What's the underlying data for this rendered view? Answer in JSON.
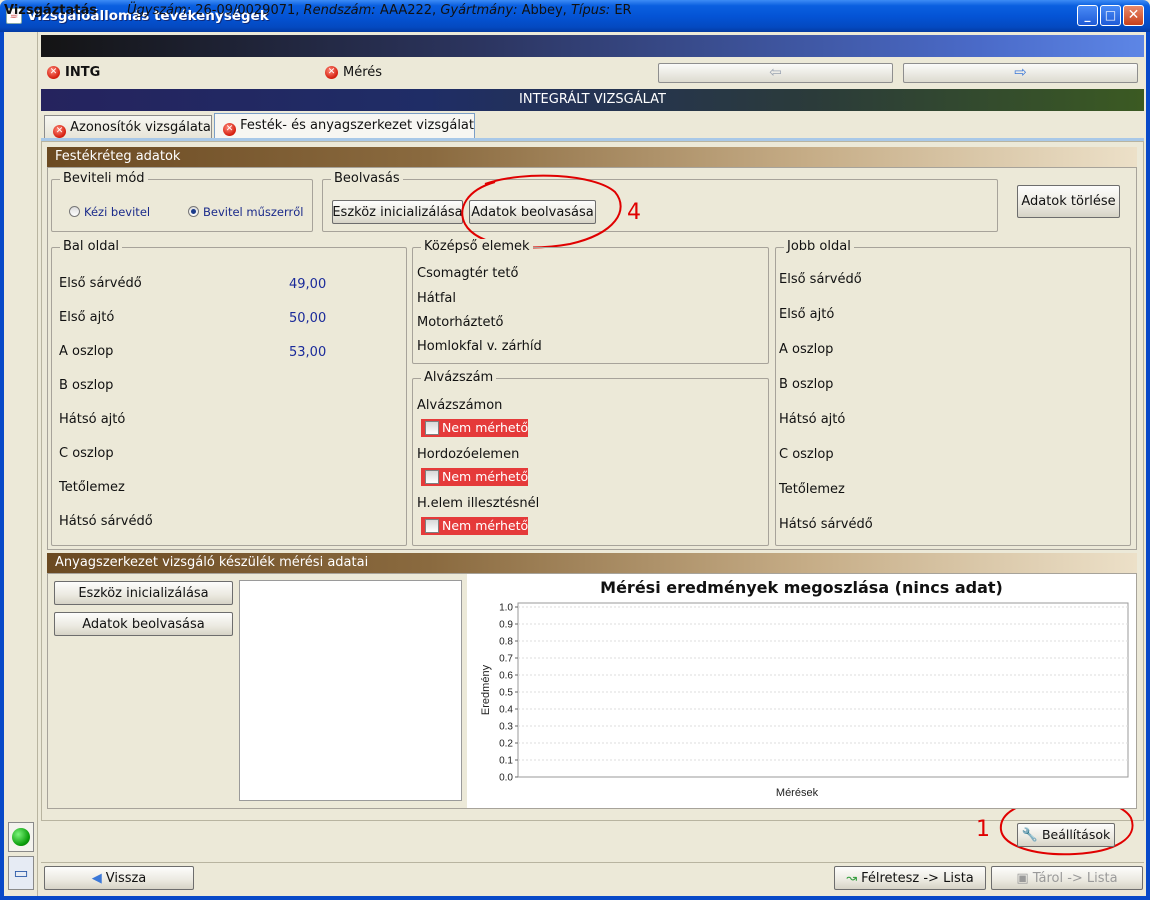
{
  "window": {
    "title": "Vizsgálóállomás tevékenységek",
    "icon_glyph": "☕",
    "minimize": "_",
    "maximize": "□",
    "close": "✕"
  },
  "header": {
    "title": "Vizsgáztatás",
    "ugyszam_label": "Ügyszám:",
    "ugyszam": "26-09/0029071,",
    "rendszam_label": "Rendszám:",
    "rendszam": "AAA222,",
    "gyartmany_label": "Gyártmány:",
    "gyartmany": "Abbey,",
    "tipus_label": "Típus:",
    "tipus": "ER"
  },
  "status_row": {
    "intg": "INTG",
    "meres": "Mérés",
    "nav_back_glyph": "⇦",
    "nav_forward_glyph": "⇨"
  },
  "banner": "INTEGRÁLT VIZSGÁLAT",
  "tabs": [
    "Azonosítók vizsgálata",
    "Festék- és anyagszerkezet vizsgálat"
  ],
  "festek": {
    "header": "Festékréteg adatok",
    "beviteli": {
      "title": "Beviteli mód",
      "options": [
        "Kézi bevitel",
        "Bevitel műszerről"
      ],
      "selected": "Bevitel műszerről"
    },
    "beolvasas": {
      "title": "Beolvasás",
      "init_button": "Eszköz inicializálása",
      "read_button": "Adatok beolvasása"
    },
    "clear_button": "Adatok törlése",
    "bal": {
      "title": "Bal oldal",
      "rows": [
        {
          "label": "Első sárvédő",
          "value": "49,00"
        },
        {
          "label": "Első ajtó",
          "value": "50,00"
        },
        {
          "label": "A oszlop",
          "value": "53,00"
        },
        {
          "label": "B oszlop",
          "value": ""
        },
        {
          "label": "Hátsó ajtó",
          "value": ""
        },
        {
          "label": "C oszlop",
          "value": ""
        },
        {
          "label": "Tetőlemez",
          "value": ""
        },
        {
          "label": "Hátsó sárvédő",
          "value": ""
        }
      ]
    },
    "kozepso": {
      "title": "Középső elemek",
      "rows": [
        "Csomagtér tető",
        "Hátfal",
        "Motorháztető",
        "Homlokfal v. zárhíd"
      ]
    },
    "alvaz": {
      "title": "Alvázszám",
      "items": [
        {
          "label": "Alvázszámon",
          "checkbox": "Nem mérhető",
          "checked": false
        },
        {
          "label": "Hordozóelemen",
          "checkbox": "Nem mérhető",
          "checked": false
        },
        {
          "label": "H.elem illesztésnél",
          "checkbox": "Nem mérhető",
          "checked": false
        }
      ]
    },
    "jobb": {
      "title": "Jobb oldal",
      "rows": [
        "Első sárvédő",
        "Első ajtó",
        "A oszlop",
        "B oszlop",
        "Hátsó ajtó",
        "C oszlop",
        "Tetőlemez",
        "Hátsó sárvédő"
      ]
    }
  },
  "anyag": {
    "header": "Anyagszerkezet vizsgáló készülék mérési adatai",
    "init_button": "Eszköz inicializálása",
    "read_button": "Adatok beolvasása"
  },
  "chart_data": {
    "type": "bar",
    "title": "Mérési eredmények megoszlása (nincs adat)",
    "xlabel": "Mérések",
    "ylabel": "Eredmény",
    "categories": [],
    "values": [],
    "ylim": [
      0.0,
      1.0
    ],
    "yticks": [
      "0.0",
      "0.1",
      "0.2",
      "0.3",
      "0.4",
      "0.5",
      "0.6",
      "0.7",
      "0.8",
      "0.9",
      "1.0"
    ],
    "grid": true
  },
  "annotations": {
    "four": "4",
    "one": "1"
  },
  "footer": {
    "settings_button": "Beállítások",
    "back_button": "Vissza",
    "park_button": "Félretesz -> Lista",
    "store_button": "Tárol -> Lista"
  },
  "colors": {
    "accent": "#0454d6",
    "error_red": "#e53a3a",
    "status_green": "#0b9e0b",
    "annotation_red": "#e00000"
  }
}
